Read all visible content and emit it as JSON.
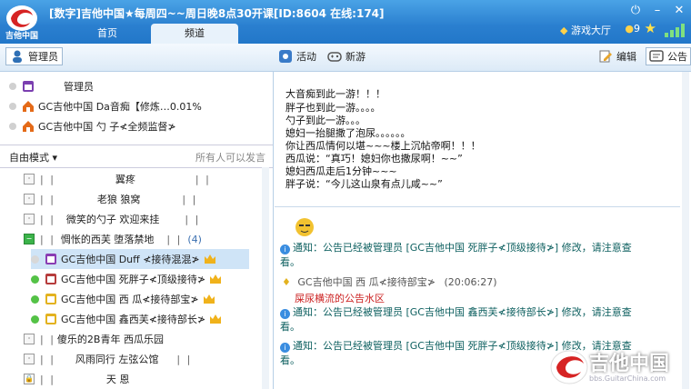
{
  "window": {
    "title": "[数字]吉他中国★每周四~~周日晚8点30开课[ID:8604 在线:174]",
    "logo_text": "吉他中国"
  },
  "tabs": [
    {
      "label": "首页"
    },
    {
      "label": "频道"
    }
  ],
  "top_right": {
    "lobby": "游戏大厅",
    "coins": "9"
  },
  "toolbar": {
    "admin": "管理员",
    "activity": "活动",
    "new_game": "新游",
    "edit": "编辑",
    "notice": "公告"
  },
  "admins": {
    "header": "管理员",
    "items": [
      "GC吉他中国 Da音痴【修炼…0.01%",
      "GC吉他中国 勺  子≮全频监督≯"
    ]
  },
  "mode": {
    "label": "自由模式",
    "note": "所有人可以发言"
  },
  "tree": {
    "rooms": [
      {
        "name": "翼疼"
      },
      {
        "name": "老狼  狼窝"
      },
      {
        "name": "微笑的勺子  欢迎来挂"
      },
      {
        "name": "惆怅的西芙  堕落禁地",
        "count": "(4)"
      }
    ],
    "users": [
      "GC吉他中国 Duff  ≮接待混混≯",
      "GC吉他中国 死胖子≮顶级接待≯",
      "GC吉他中国 西  瓜≮接待部宝≯",
      "GC吉他中国 鑫西芙≮接待部长≯"
    ],
    "rooms2": [
      {
        "name": "傻乐的2B青年  西瓜乐园"
      },
      {
        "name": "风雨同行  左弦公馆"
      },
      {
        "name": "天  恩"
      }
    ]
  },
  "topic": [
    "大音痴到此一游！！！",
    "胖子也到此一游。。。。",
    "勺子到此一游。。。",
    "媳妇一抬腿撒了泡尿。。。。。。",
    "你让西瓜情何以堪~~~楼上沉帖帝啊！！！",
    "西瓜说：“真巧！媳妇你也撒尿啊！~~”",
    "媳妇西瓜走后1分钟~~~",
    "胖子说：“今儿这山泉有点儿咸~~”"
  ],
  "messages": {
    "notice1_a": "通知：公告已经被管理员 [GC吉他中国 死胖子≮顶级接待≯] 修改，请注意查",
    "notice1_b": "看。",
    "sender": "GC吉他中国 西  瓜≮接待部宝≯",
    "time": "(20:06:27)",
    "chat_text": "屎尿横流的公告水区",
    "notice2_a": "通知：公告已经被管理员 [GC吉他中国 鑫西芙≮接待部长≯] 修改，请注意查",
    "notice2_b": "看。",
    "notice3_a": "通知：公告已经被管理员 [GC吉他中国 死胖子≮顶级接待≯] 修改，请注意查",
    "notice3_b": "看。"
  },
  "watermark": {
    "brand": "吉他中国",
    "url": "bbs.GuitarChina.com"
  },
  "colors": {
    "title_bar": "#2a7fcf",
    "notice_text": "#0c5f5f",
    "chat_text": "#cc2222"
  }
}
